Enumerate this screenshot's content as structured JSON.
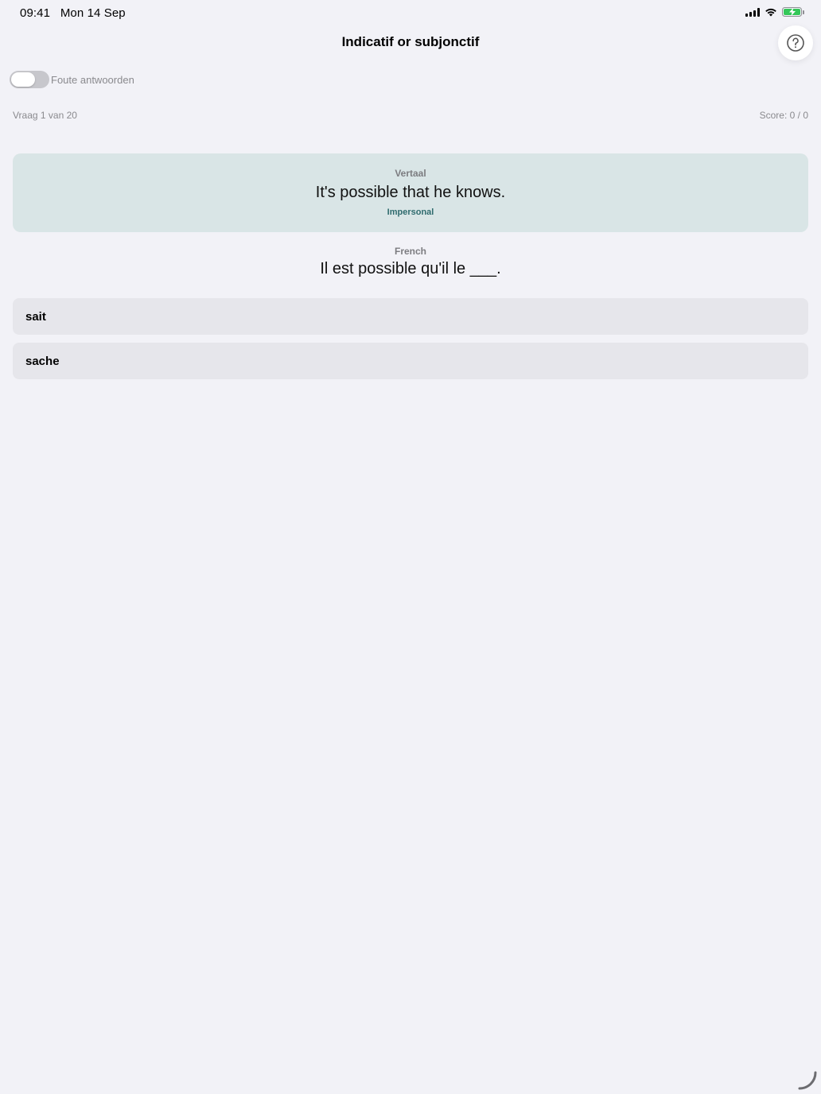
{
  "status_bar": {
    "time_date": "09:41   Mon 14 Sep",
    "battery_color": "#34c759"
  },
  "header": {
    "title": "Indicatif or subjonctif",
    "help_icon": "question-circle-icon"
  },
  "toggle": {
    "label": "Foute antwoorden",
    "on": false
  },
  "progress": {
    "question": "Vraag 1 van 20",
    "score": "Score: 0 / 0"
  },
  "prompt": {
    "caption": "Vertaal",
    "text": "It's possible that he knows.",
    "tag": "Impersonal",
    "card_color": "#d9e5e6"
  },
  "question": {
    "caption": "French",
    "text": "Il est possible qu'il le ___."
  },
  "options": [
    {
      "label": "sait"
    },
    {
      "label": "sache"
    }
  ]
}
